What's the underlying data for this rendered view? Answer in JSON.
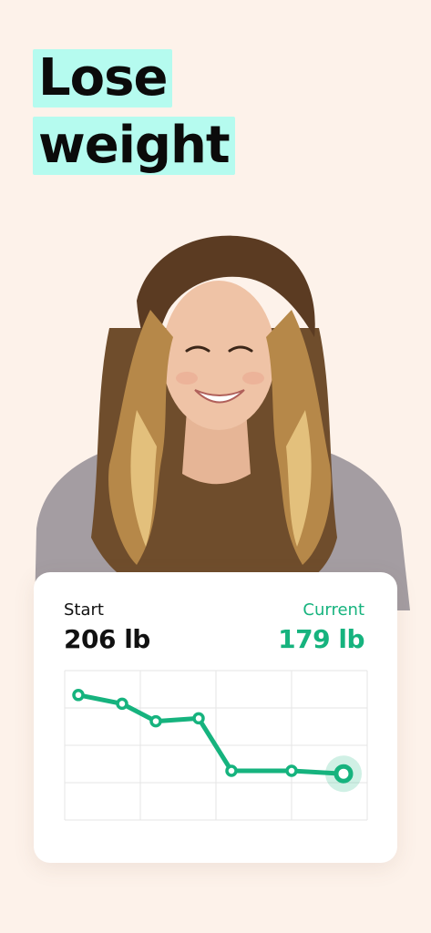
{
  "headline": {
    "line1": "Lose",
    "line2": "weight"
  },
  "photo": {
    "icon": "smiling-woman-photo"
  },
  "card": {
    "start_label": "Start",
    "start_value": "206 lb",
    "current_label": "Current",
    "current_value": "179 lb"
  },
  "colors": {
    "background": "#fdf2ea",
    "highlight": "#b5fbef",
    "accent": "#16b37e",
    "text": "#111111"
  },
  "chart_data": {
    "type": "line",
    "title": "",
    "xlabel": "",
    "ylabel": "",
    "ylim": [
      170,
      210
    ],
    "grid": true,
    "series": [
      {
        "values": [
          206,
          203,
          197,
          198,
          180,
          180,
          179
        ]
      }
    ]
  }
}
